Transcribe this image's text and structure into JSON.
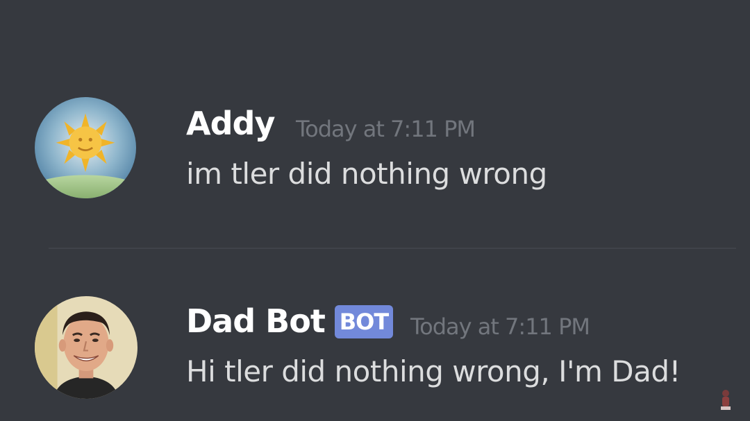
{
  "channel": {
    "messages": [
      {
        "author": "Addy",
        "timestamp": "Today at 7:11 PM",
        "content": "im tler did nothing wrong",
        "avatar": "sun-avatar",
        "is_bot": false
      },
      {
        "author": "Dad Bot",
        "bot_tag": "BOT",
        "timestamp": "Today at 7:11 PM",
        "content": "Hi tler did nothing wrong, I'm Dad!",
        "avatar": "man-avatar",
        "is_bot": true
      }
    ]
  },
  "colors": {
    "background": "#36393f",
    "username": "#ffffff",
    "message_text": "#dcddde",
    "timestamp": "#72767d",
    "bot_tag": "#7289da",
    "divider": "#40434a"
  },
  "icons": {
    "corner": "watermark-icon"
  }
}
